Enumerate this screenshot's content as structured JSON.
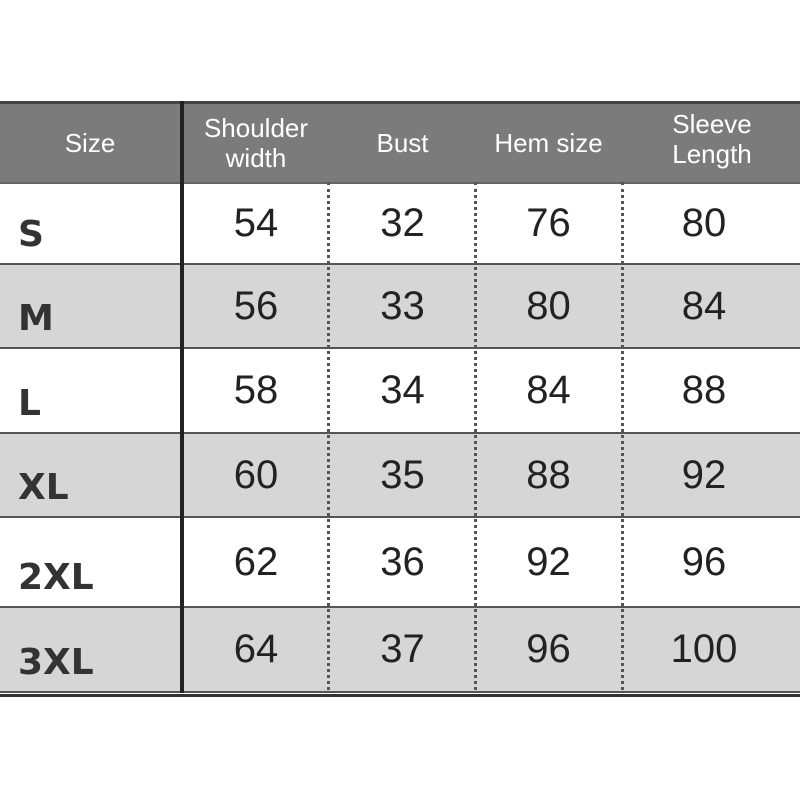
{
  "headers": [
    "Size",
    "Shoulder width",
    "Bust",
    "Hem size",
    "Sleeve Length"
  ],
  "rows": [
    {
      "size": "S",
      "values": [
        "54",
        "32",
        "76",
        "80"
      ]
    },
    {
      "size": "M",
      "values": [
        "56",
        "33",
        "80",
        "84"
      ]
    },
    {
      "size": "L",
      "values": [
        "58",
        "34",
        "84",
        "88"
      ]
    },
    {
      "size": "XL",
      "values": [
        "60",
        "35",
        "88",
        "92"
      ]
    },
    {
      "size": "2XL",
      "values": [
        "62",
        "36",
        "92",
        "96"
      ]
    },
    {
      "size": "3XL",
      "values": [
        "64",
        "37",
        "96",
        "100"
      ]
    }
  ],
  "colors": {
    "header_bg": "#7b7b7b",
    "stripe_bg": "#d6d6d6"
  }
}
